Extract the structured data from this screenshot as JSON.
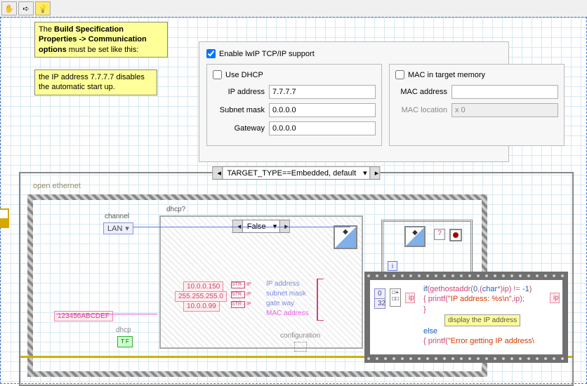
{
  "toolbar": {
    "hand": "✋",
    "arrow": "➪",
    "bulb": "💡"
  },
  "notes": {
    "n1_a": "The ",
    "n1_b": "Build Specification Properties -> Communication options",
    "n1_c": " must be set like this:",
    "n2": "the IP address 7.7.7.7 disables the automatic start up."
  },
  "panel": {
    "enable": "Enable lwIP TCP/IP support",
    "dhcp": "Use DHCP",
    "ip_lbl": "IP address",
    "ip": "7.7.7.7",
    "sn_lbl": "Subnet mask",
    "sn": "0.0.0.0",
    "gw_lbl": "Gateway",
    "gw": "0.0.0.0",
    "mac_mem": "MAC in target memory",
    "mac_lbl": "MAC address",
    "mac": "",
    "loc_lbl": "MAC location",
    "loc": "x 0"
  },
  "diag": {
    "case": "TARGET_TYPE==Embedded, default",
    "open": "open ethernet",
    "channel": "channel",
    "lan": "LAN",
    "dhcp_q": "dhcp?",
    "false": "False",
    "ip_c": "10.0.0.150",
    "sn_c": "255.255.255.0",
    "gw_c": "10.0.0.99",
    "mac_c": "123456ABCDEF",
    "ip_l": "IP address",
    "sn_l": "subnet mask",
    "gw_l": "gate way",
    "mac_l": "MAC address",
    "cfg": "configuration",
    "dhcp_l": "dhcp",
    "blue0": "0",
    "blue32": "32",
    "ip_s": "ip",
    "i": "i",
    "str2ip": "STR→IP",
    "code1": "if",
    "code1p": "(gethostaddr(",
    "code1n": "0",
    "code1c": ",(",
    "code1t": "char",
    "code1r": "*)ip) != ",
    "code1m": "-1",
    "code1e": ")",
    "code2": "{   printf(",
    "code2s": "\"IP address: %s\\n\"",
    "code2e": ",ip);",
    "code3": "}",
    "code4": "else",
    "code5": "{   printf(",
    "code5s": "\"Error getting IP address\\",
    "code5e": "",
    "disp": "display the IP address"
  }
}
